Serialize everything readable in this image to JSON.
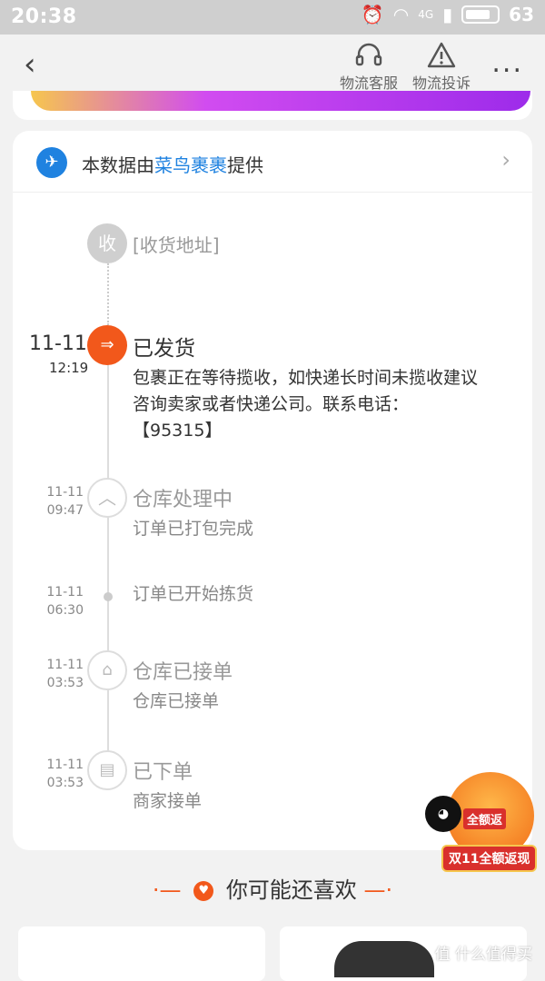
{
  "status": {
    "time": "20:38",
    "network": "4G",
    "battery": "63"
  },
  "nav": {
    "back_icon": "chevron-left-icon",
    "actions": [
      {
        "label": "物流客服",
        "icon": "headset-icon"
      },
      {
        "label": "物流投诉",
        "icon": "warning-icon"
      }
    ],
    "more": "..."
  },
  "provider": {
    "prefix": "本数据由",
    "name": "菜鸟裹裹",
    "suffix": "提供"
  },
  "timeline": {
    "receive": {
      "badge": "收",
      "text": "[收货地址]"
    },
    "events": [
      {
        "date": "11-11",
        "time": "12:19",
        "title": "已发货",
        "desc": "包裹正在等待揽收，如快递长时间未揽收建议咨询卖家或者快递公司。联系电话：【95315】"
      },
      {
        "date": "11-11",
        "time": "09:47",
        "title": "仓库处理中",
        "desc": "订单已打包完成"
      },
      {
        "date": "11-11",
        "time": "06:30",
        "title": "",
        "desc": "订单已开始拣货"
      },
      {
        "date": "11-11",
        "time": "03:53",
        "title": "仓库已接单",
        "desc": "仓库已接单"
      },
      {
        "date": "11-11",
        "time": "03:53",
        "title": "已下单",
        "desc": "商家接单"
      }
    ]
  },
  "recommend": {
    "title": "你可能还喜欢"
  },
  "promo": {
    "badge": "全额返",
    "label": "双11全额返现"
  },
  "watermark": "值 什么值得买",
  "colors": {
    "accent": "#f2581b",
    "provider_blue": "#1f82e0"
  }
}
